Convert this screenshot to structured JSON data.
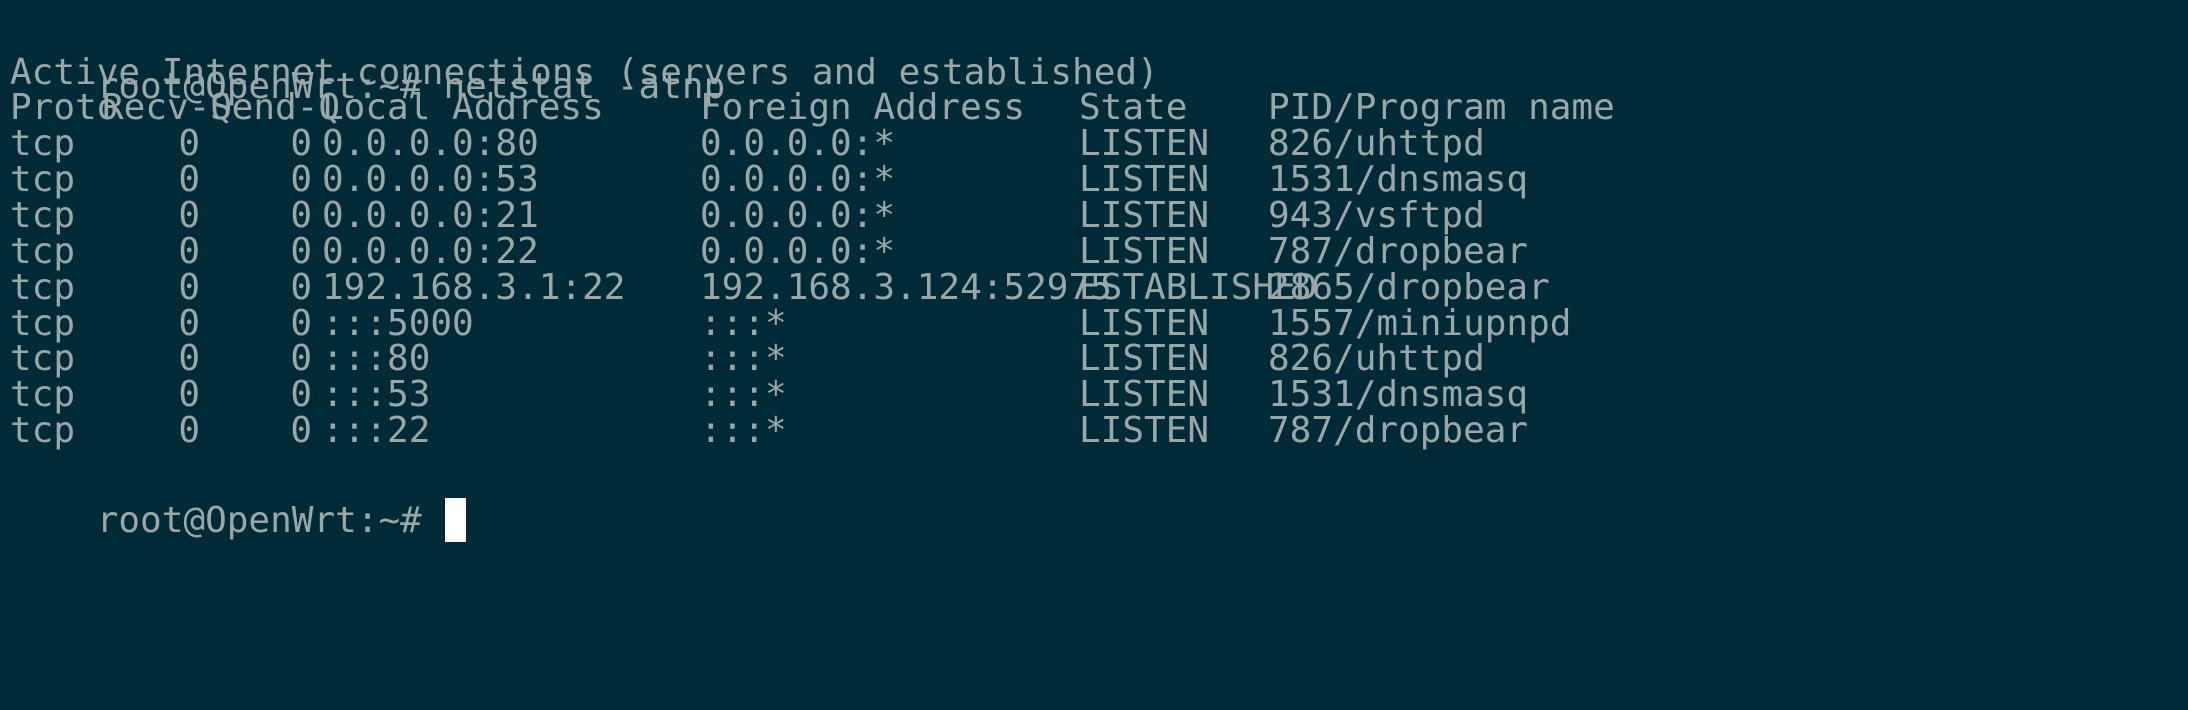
{
  "terminal": {
    "top_rule": "-----------------------------------------------------",
    "command_prompt": "root@OpenWrt:~# ",
    "command": "netstat -atnp",
    "banner": "Active Internet connections (servers and established)",
    "headers": {
      "proto": "Proto",
      "recvq": "Recv-Q",
      "sendq": "Send-Q",
      "local": "Local Address",
      "foreign": "Foreign Address",
      "state": "State",
      "pid": "PID/Program name"
    },
    "rows": [
      {
        "proto": "tcp",
        "recvq": "0",
        "sendq": "0",
        "local": "0.0.0.0:80",
        "foreign": "0.0.0.0:*",
        "state": "LISTEN",
        "pid": "826/uhttpd"
      },
      {
        "proto": "tcp",
        "recvq": "0",
        "sendq": "0",
        "local": "0.0.0.0:53",
        "foreign": "0.0.0.0:*",
        "state": "LISTEN",
        "pid": "1531/dnsmasq"
      },
      {
        "proto": "tcp",
        "recvq": "0",
        "sendq": "0",
        "local": "0.0.0.0:21",
        "foreign": "0.0.0.0:*",
        "state": "LISTEN",
        "pid": "943/vsftpd"
      },
      {
        "proto": "tcp",
        "recvq": "0",
        "sendq": "0",
        "local": "0.0.0.0:22",
        "foreign": "0.0.0.0:*",
        "state": "LISTEN",
        "pid": "787/dropbear"
      },
      {
        "proto": "tcp",
        "recvq": "0",
        "sendq": "0",
        "local": "192.168.3.1:22",
        "foreign": "192.168.3.124:52975",
        "state": "ESTABLISHED",
        "pid": "2865/dropbear"
      },
      {
        "proto": "tcp",
        "recvq": "0",
        "sendq": "0",
        "local": ":::5000",
        "foreign": ":::*",
        "state": "LISTEN",
        "pid": "1557/miniupnpd"
      },
      {
        "proto": "tcp",
        "recvq": "0",
        "sendq": "0",
        "local": ":::80",
        "foreign": ":::*",
        "state": "LISTEN",
        "pid": "826/uhttpd"
      },
      {
        "proto": "tcp",
        "recvq": "0",
        "sendq": "0",
        "local": ":::53",
        "foreign": ":::*",
        "state": "LISTEN",
        "pid": "1531/dnsmasq"
      },
      {
        "proto": "tcp",
        "recvq": "0",
        "sendq": "0",
        "local": ":::22",
        "foreign": ":::*",
        "state": "LISTEN",
        "pid": "787/dropbear"
      }
    ],
    "final_prompt": "root@OpenWrt:~# ",
    "colors": {
      "background": "#002b36",
      "text": "#9aa7a8",
      "cursor": "#ffffff"
    }
  }
}
